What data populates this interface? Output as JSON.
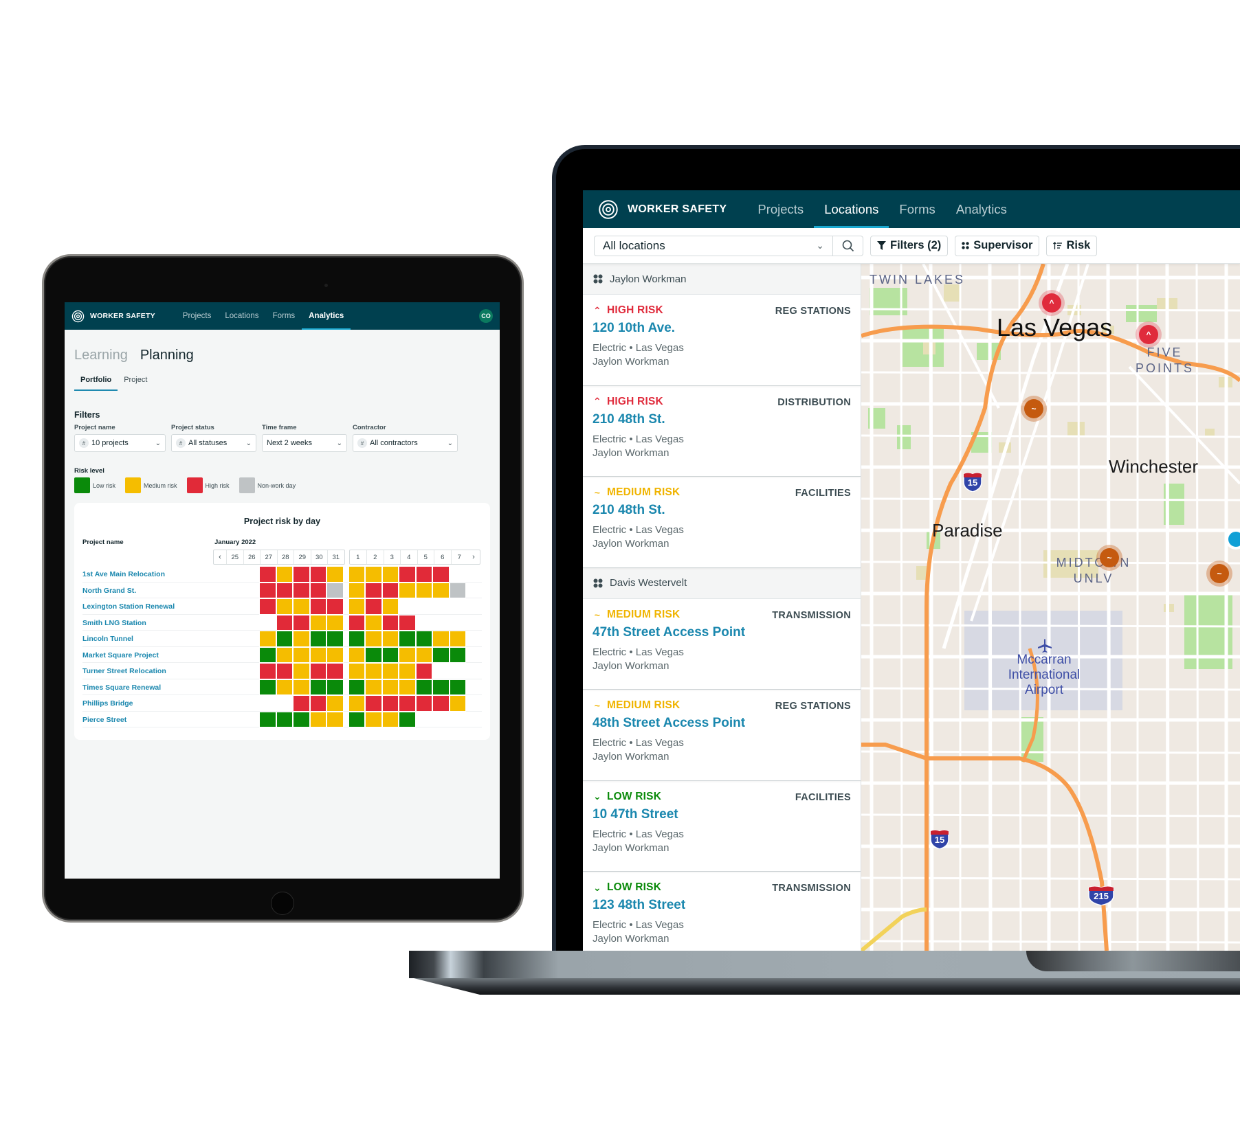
{
  "tablet": {
    "header": {
      "brand": "WORKER SAFETY",
      "nav": [
        {
          "label": "Projects",
          "active": false
        },
        {
          "label": "Locations",
          "active": false
        },
        {
          "label": "Forms",
          "active": false
        },
        {
          "label": "Analytics",
          "active": true
        }
      ],
      "avatar_initials": "CO"
    },
    "big_tabs": [
      {
        "label": "Learning",
        "active": false
      },
      {
        "label": "Planning",
        "active": true
      }
    ],
    "sub_tabs": [
      {
        "label": "Portfolio",
        "active": true
      },
      {
        "label": "Project",
        "active": false
      }
    ],
    "filters": {
      "title": "Filters",
      "fields": [
        {
          "label": "Project name",
          "value": "10 projects",
          "has_hash": true
        },
        {
          "label": "Project status",
          "value": "All statuses",
          "has_hash": true
        },
        {
          "label": "Time frame",
          "value": "Next 2 weeks",
          "has_hash": false
        },
        {
          "label": "Contractor",
          "value": "All contractors",
          "has_hash": true
        }
      ],
      "hash_symbol": "#",
      "chevron": "⌄"
    },
    "risk_legend": {
      "title": "Risk level",
      "items": [
        {
          "key": "L",
          "label": "Low risk",
          "color": "#0a8a0a"
        },
        {
          "key": "M",
          "label": "Medium risk",
          "color": "#f5bd00"
        },
        {
          "key": "H",
          "label": "High risk",
          "color": "#e12a38"
        },
        {
          "key": "N",
          "label": "Non-work day",
          "color": "#bfc3c5"
        }
      ]
    }
  },
  "chart_data": {
    "type": "heatmap",
    "title": "Project risk by day",
    "row_header": "Project name",
    "month_label": "January 2022",
    "prev_label": "‹",
    "next_label": "›",
    "column_groups": [
      [
        "25",
        "26",
        "27",
        "28",
        "29",
        "30",
        "31"
      ],
      [
        "1",
        "2",
        "3",
        "4",
        "5",
        "6",
        "7"
      ]
    ],
    "value_legend": {
      "L": "Low risk",
      "M": "Medium risk",
      "H": "High risk",
      "N": "Non-work day",
      "": "No data"
    },
    "rows": [
      {
        "name": "1st Ave Main Relocation",
        "values": [
          "",
          "",
          "H",
          "M",
          "H",
          "H",
          "M",
          "M",
          "M",
          "M",
          "H",
          "H",
          "H",
          ""
        ]
      },
      {
        "name": "North Grand St.",
        "values": [
          "",
          "",
          "H",
          "H",
          "H",
          "H",
          "N",
          "M",
          "H",
          "H",
          "M",
          "M",
          "M",
          "N"
        ]
      },
      {
        "name": "Lexington Station Renewal",
        "values": [
          "",
          "",
          "H",
          "M",
          "M",
          "H",
          "H",
          "M",
          "H",
          "M",
          "",
          "",
          "",
          ""
        ]
      },
      {
        "name": "Smith LNG Station",
        "values": [
          "",
          "",
          "",
          "H",
          "H",
          "M",
          "M",
          "H",
          "M",
          "H",
          "H",
          "",
          "",
          ""
        ]
      },
      {
        "name": "Lincoln Tunnel",
        "values": [
          "",
          "",
          "M",
          "L",
          "M",
          "L",
          "L",
          "L",
          "M",
          "M",
          "L",
          "L",
          "M",
          "M"
        ]
      },
      {
        "name": "Market Square Project",
        "values": [
          "",
          "",
          "L",
          "M",
          "M",
          "M",
          "M",
          "M",
          "L",
          "L",
          "M",
          "M",
          "L",
          "L"
        ]
      },
      {
        "name": "Turner Street Relocation",
        "values": [
          "",
          "",
          "H",
          "H",
          "M",
          "H",
          "H",
          "M",
          "M",
          "M",
          "M",
          "H",
          "",
          ""
        ]
      },
      {
        "name": "Times Square Renewal",
        "values": [
          "",
          "",
          "L",
          "M",
          "M",
          "L",
          "L",
          "L",
          "M",
          "M",
          "M",
          "L",
          "L",
          "L"
        ]
      },
      {
        "name": "Phillips Bridge",
        "values": [
          "",
          "",
          "",
          "",
          "H",
          "H",
          "M",
          "M",
          "H",
          "H",
          "H",
          "H",
          "H",
          "M"
        ]
      },
      {
        "name": "Pierce Street",
        "values": [
          "",
          "",
          "L",
          "L",
          "L",
          "M",
          "M",
          "L",
          "M",
          "M",
          "L",
          "",
          "",
          ""
        ]
      }
    ]
  },
  "laptop": {
    "header": {
      "brand": "WORKER SAFETY",
      "nav": [
        {
          "label": "Projects",
          "active": false
        },
        {
          "label": "Locations",
          "active": true
        },
        {
          "label": "Forms",
          "active": false
        },
        {
          "label": "Analytics",
          "active": false
        }
      ]
    },
    "toolbar": {
      "location_select": "All locations",
      "chevron": "⌄",
      "filters_label": "Filters (2)",
      "supervisor_label": "Supervisor",
      "risk_label": "Risk"
    },
    "groups": [
      {
        "supervisor": "Jaylon Workman",
        "items": [
          {
            "risk": "HIGH RISK",
            "level": "high",
            "category": "REG STATIONS",
            "title": "120 10th Ave.",
            "meta": "Electric • Las Vegas",
            "person": "Jaylon Workman"
          },
          {
            "risk": "HIGH RISK",
            "level": "high",
            "category": "DISTRIBUTION",
            "title": "210 48th St.",
            "meta": "Electric • Las Vegas",
            "person": "Jaylon Workman"
          },
          {
            "risk": "MEDIUM RISK",
            "level": "medium",
            "category": "FACILITIES",
            "title": "210 48th St.",
            "meta": "Electric • Las Vegas",
            "person": "Jaylon Workman"
          }
        ]
      },
      {
        "supervisor": "Davis Westervelt",
        "items": [
          {
            "risk": "MEDIUM RISK",
            "level": "medium",
            "category": "TRANSMISSION",
            "title": "47th Street Access Point",
            "meta": "Electric • Las Vegas",
            "person": "Jaylon Workman"
          },
          {
            "risk": "MEDIUM RISK",
            "level": "medium",
            "category": "REG STATIONS",
            "title": "48th Street Access Point",
            "meta": "Electric • Las Vegas",
            "person": "Jaylon Workman"
          },
          {
            "risk": "LOW RISK",
            "level": "low",
            "category": "FACILITIES",
            "title": "10 47th Street",
            "meta": "Electric • Las Vegas",
            "person": "Jaylon Workman"
          },
          {
            "risk": "LOW RISK",
            "level": "low",
            "category": "TRANSMISSION",
            "title": "123 48th Street",
            "meta": "Electric • Las Vegas",
            "person": "Jaylon Workman"
          }
        ]
      }
    ],
    "risk_styles": {
      "high": {
        "color": "#e02b3c",
        "icon": "⌃"
      },
      "medium": {
        "color": "#f0b400",
        "icon": "~"
      },
      "low": {
        "color": "#0a8a0a",
        "icon": "⌄"
      }
    },
    "map": {
      "labels": {
        "twin_lakes": "TWIN LAKES",
        "las_vegas": "Las Vegas",
        "five": "FIVE",
        "points": "POINTS",
        "winchester": "Winchester",
        "paradise": "Paradise",
        "midtown": "MIDTOWN",
        "unlv": "UNLV",
        "airport_1": "Mccarran",
        "airport_2": "International",
        "airport_3": "Airport"
      },
      "shields": [
        "15",
        "15",
        "215"
      ],
      "markers": [
        {
          "level": "high",
          "glyph": "^"
        },
        {
          "level": "high",
          "glyph": "^"
        },
        {
          "level": "medium",
          "glyph": "~"
        },
        {
          "level": "medium",
          "glyph": "~"
        },
        {
          "level": "medium",
          "glyph": "~"
        },
        {
          "level": "current",
          "glyph": ""
        }
      ]
    }
  }
}
